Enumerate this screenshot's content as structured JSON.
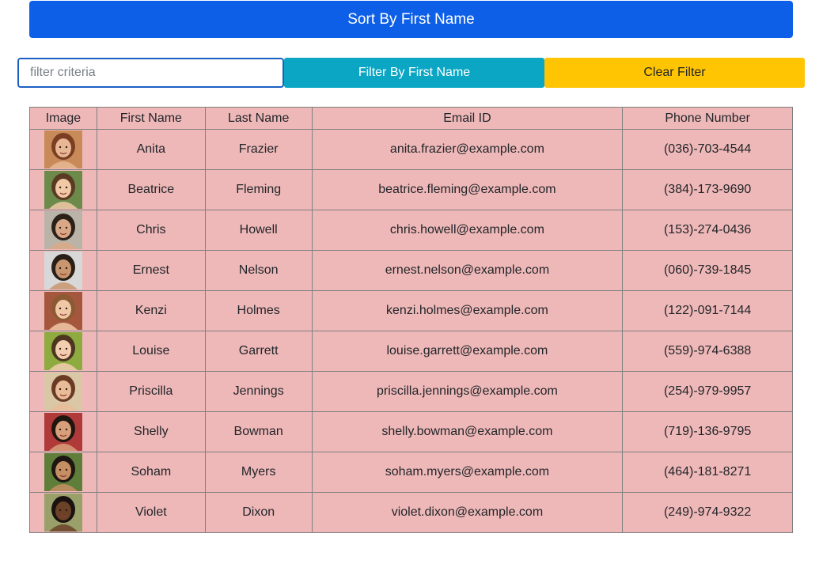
{
  "toolbar": {
    "sort_label": "Sort By First Name",
    "filter_placeholder": "filter criteria",
    "filter_value": "",
    "filter_label": "Filter By First Name",
    "clear_label": "Clear Filter"
  },
  "table": {
    "headers": [
      "Image",
      "First Name",
      "Last Name",
      "Email ID",
      "Phone Number"
    ],
    "rows": [
      {
        "first": "Anita",
        "last": "Frazier",
        "email": "anita.frazier@example.com",
        "phone": "(036)-703-4544",
        "bg": "#c98a5a",
        "skin": "#e8b896",
        "hair": "#7a3e22"
      },
      {
        "first": "Beatrice",
        "last": "Fleming",
        "email": "beatrice.fleming@example.com",
        "phone": "(384)-173-9690",
        "bg": "#6c8a4a",
        "skin": "#f1c9a7",
        "hair": "#5a3a22"
      },
      {
        "first": "Chris",
        "last": "Howell",
        "email": "chris.howell@example.com",
        "phone": "(153)-274-0436",
        "bg": "#b9b3a8",
        "skin": "#d9a987",
        "hair": "#2b2119"
      },
      {
        "first": "Ernest",
        "last": "Nelson",
        "email": "ernest.nelson@example.com",
        "phone": "(060)-739-1845",
        "bg": "#d8d8d8",
        "skin": "#c99670",
        "hair": "#2a1f17"
      },
      {
        "first": "Kenzi",
        "last": "Holmes",
        "email": "kenzi.holmes@example.com",
        "phone": "(122)-091-7144",
        "bg": "#a5573d",
        "skin": "#f0c8a6",
        "hair": "#8b5a33"
      },
      {
        "first": "Louise",
        "last": "Garrett",
        "email": "louise.garrett@example.com",
        "phone": "(559)-974-6388",
        "bg": "#8dab3f",
        "skin": "#f2cdb0",
        "hair": "#4e3520"
      },
      {
        "first": "Priscilla",
        "last": "Jennings",
        "email": "priscilla.jennings@example.com",
        "phone": "(254)-979-9957",
        "bg": "#d9c7a6",
        "skin": "#e8bc98",
        "hair": "#6b3a24"
      },
      {
        "first": "Shelly",
        "last": "Bowman",
        "email": "shelly.bowman@example.com",
        "phone": "(719)-136-9795",
        "bg": "#b03a3a",
        "skin": "#d8a07a",
        "hair": "#1f1610"
      },
      {
        "first": "Soham",
        "last": "Myers",
        "email": "soham.myers@example.com",
        "phone": "(464)-181-8271",
        "bg": "#5e7e3a",
        "skin": "#c58e63",
        "hair": "#1d1612"
      },
      {
        "first": "Violet",
        "last": "Dixon",
        "email": "violet.dixon@example.com",
        "phone": "(249)-974-9322",
        "bg": "#9aa06a",
        "skin": "#6b4228",
        "hair": "#1a1210"
      }
    ]
  },
  "colors": {
    "sort_button": "#0d5fe8",
    "filter_button": "#0aa6c4",
    "clear_button": "#ffc402",
    "table_background": "#efb8b8"
  },
  "icons": {
    "avatar": "user-photo"
  }
}
